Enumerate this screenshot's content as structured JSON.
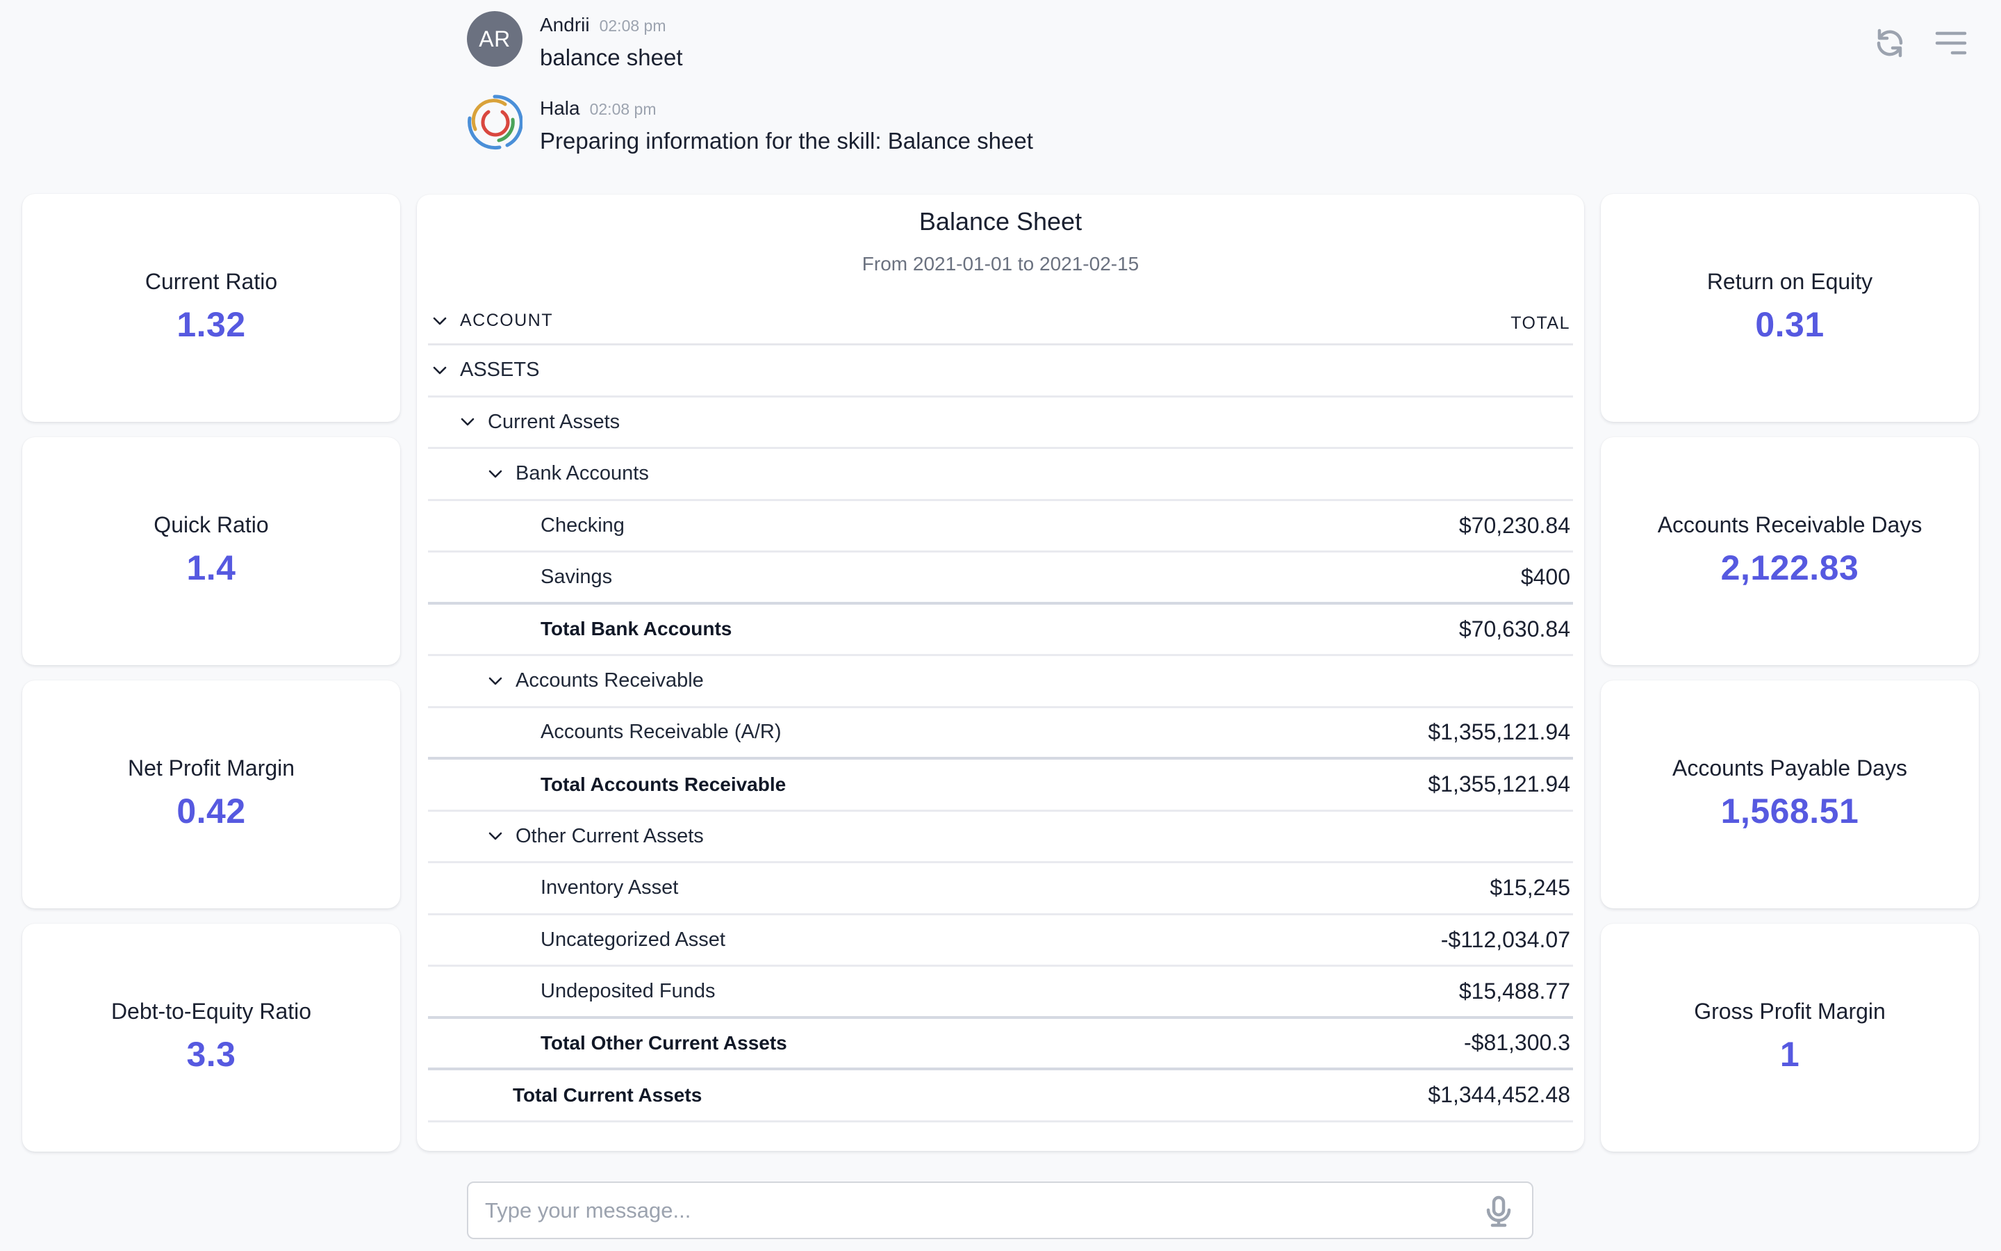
{
  "chat": {
    "messages": [
      {
        "author": "Andrii",
        "initials": "AR",
        "time": "02:08 pm",
        "text": "balance sheet",
        "avatar": "initials-avatar"
      },
      {
        "author": "Hala",
        "time": "02:08 pm",
        "text": "Preparing information for the skill: Balance sheet",
        "avatar": "hala-logo"
      }
    ]
  },
  "toolbar": {
    "icons": [
      "refresh-icon",
      "menu-icon"
    ]
  },
  "kpis_left": [
    {
      "label": "Current Ratio",
      "value": "1.32"
    },
    {
      "label": "Quick Ratio",
      "value": "1.4"
    },
    {
      "label": "Net Profit Margin",
      "value": "0.42"
    },
    {
      "label": "Debt-to-Equity Ratio",
      "value": "3.3"
    }
  ],
  "kpis_right": [
    {
      "label": "Return on Equity",
      "value": "0.31"
    },
    {
      "label": "Accounts Receivable Days",
      "value": "2,122.83"
    },
    {
      "label": "Accounts Payable Days",
      "value": "1,568.51"
    },
    {
      "label": "Gross Profit Margin",
      "value": "1"
    }
  ],
  "balance_sheet": {
    "title": "Balance Sheet",
    "subtitle": "From 2021-01-01 to 2021-02-15",
    "columns": {
      "account": "ACCOUNT",
      "total": "TOTAL"
    },
    "rows": [
      {
        "label": "ASSETS",
        "amount": "",
        "type": "group"
      },
      {
        "label": "Current Assets",
        "amount": "",
        "type": "group"
      },
      {
        "label": "Bank Accounts",
        "amount": "",
        "type": "group"
      },
      {
        "label": "Checking",
        "amount": "$70,230.84",
        "type": "item"
      },
      {
        "label": "Savings",
        "amount": "$400",
        "type": "item"
      },
      {
        "label": "Total Bank Accounts",
        "amount": "$70,630.84",
        "type": "total"
      },
      {
        "label": "Accounts Receivable",
        "amount": "",
        "type": "group"
      },
      {
        "label": "Accounts Receivable (A/R)",
        "amount": "$1,355,121.94",
        "type": "item"
      },
      {
        "label": "Total Accounts Receivable",
        "amount": "$1,355,121.94",
        "type": "total"
      },
      {
        "label": "Other Current Assets",
        "amount": "",
        "type": "group"
      },
      {
        "label": "Inventory Asset",
        "amount": "$15,245",
        "type": "item"
      },
      {
        "label": "Uncategorized Asset",
        "amount": "-$112,034.07",
        "type": "item"
      },
      {
        "label": "Undeposited Funds",
        "amount": "$15,488.77",
        "type": "item"
      },
      {
        "label": "Total Other Current Assets",
        "amount": "-$81,300.3",
        "type": "total"
      },
      {
        "label": "Total Current Assets",
        "amount": "$1,344,452.48",
        "type": "total"
      }
    ]
  },
  "composer": {
    "placeholder": "Type your message...",
    "value": ""
  },
  "colors": {
    "accent": "#5659e0",
    "background": "#f8f9fb",
    "avatar_gray": "#6b7180"
  }
}
